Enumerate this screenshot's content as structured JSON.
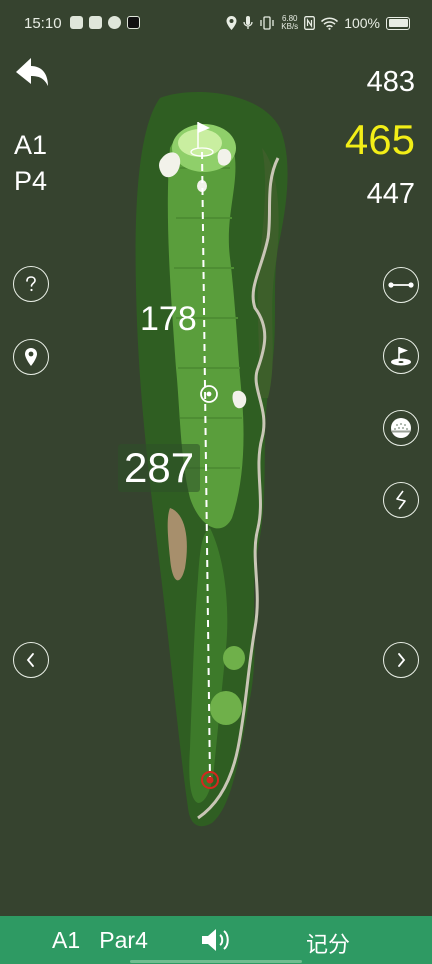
{
  "status_bar": {
    "time": "15:10",
    "speed": "6.80\nKB/s",
    "battery": "100%",
    "left_icons": [
      "cat-app-icon",
      "mail-app-icon",
      "leaf-app-icon",
      "tiktok-icon"
    ],
    "right_icons": [
      "location-icon",
      "mic-icon",
      "vibrate-icon",
      "nfc-icon",
      "wifi-icon",
      "battery-icon"
    ]
  },
  "hole": {
    "name": "A1",
    "par": "P4"
  },
  "yardages": {
    "back": "483",
    "middle": "465",
    "front": "447"
  },
  "distances": {
    "layup": "178",
    "tee_to_target": "287"
  },
  "colors": {
    "background": "#36432f",
    "accent_yellow": "#f2ee17",
    "bottom_bar": "#2e9a63",
    "fairway": "#5a9e3c",
    "green": "#c9eea0",
    "tee_marker": "#d4271f"
  },
  "left_tools": [
    "help-icon",
    "location-pin-icon"
  ],
  "right_tools": [
    "measure-line-icon",
    "flag-green-icon",
    "golf-ball-icon",
    "zigzag-icon"
  ],
  "nav": {
    "prev": "chevron-left-icon",
    "next": "chevron-right-icon"
  },
  "bottom_bar": {
    "hole_label": "A1   Par4",
    "score_label": "记分"
  }
}
